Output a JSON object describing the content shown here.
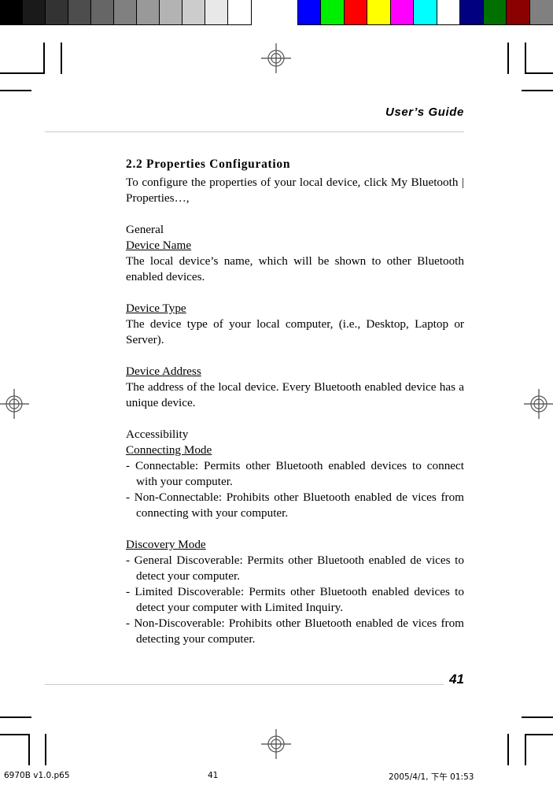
{
  "calibration": {
    "grayscale_label": "grayscale-calibration-bar",
    "grayscale_swatches": [
      "#000000",
      "#1a1a1a",
      "#333333",
      "#4d4d4d",
      "#666666",
      "#808080",
      "#999999",
      "#b3b3b3",
      "#cccccc",
      "#e8e8e8",
      "#ffffff"
    ],
    "color_label": "color-calibration-bar",
    "color_swatches": [
      "#0000ff",
      "#00ee00",
      "#fe0000",
      "#ffff00",
      "#ff00ff",
      "#00ffff",
      "#ffffff",
      "#000080",
      "#007000",
      "#8b0000",
      "#808080"
    ]
  },
  "header": {
    "title": "User’s Guide"
  },
  "content": {
    "heading": "2.2 Properties Configuration",
    "intro": "To configure the properties of your local device, click My Bluetooth | Properties…,",
    "groups": [
      {
        "group_label": "General",
        "entries": [
          {
            "label": "Device Name",
            "text": "The local device’s name, which will be shown to other Bluetooth enabled devices."
          },
          {
            "label": "Device Type",
            "text": "The device type of your local computer, (i.e., Desktop, Laptop or Server)."
          },
          {
            "label": "Device Address",
            "text": "The address of the local device. Every Bluetooth enabled device has a unique device."
          }
        ]
      },
      {
        "group_label": "Accessibility",
        "entries": [
          {
            "label": "Connecting Mode",
            "items": [
              "- Connectable: Permits other Bluetooth enabled devices to connect with your computer.",
              "- Non-Connectable: Prohibits other Bluetooth enabled de vices from connecting with your computer."
            ]
          },
          {
            "label": "Discovery Mode",
            "items": [
              "- General Discoverable: Permits other Bluetooth enabled de vices to detect your computer.",
              "- Limited Discoverable: Permits other Bluetooth enabled devices to detect your computer with Limited Inquiry.",
              "- Non-Discoverable: Prohibits other Bluetooth enabled de vices from detecting your computer."
            ]
          }
        ]
      }
    ]
  },
  "footer": {
    "page_number": "41"
  },
  "print_info": {
    "file": "6970B v1.0.p65",
    "page": "41",
    "date": "2005/4/1, 下午 01:53"
  }
}
